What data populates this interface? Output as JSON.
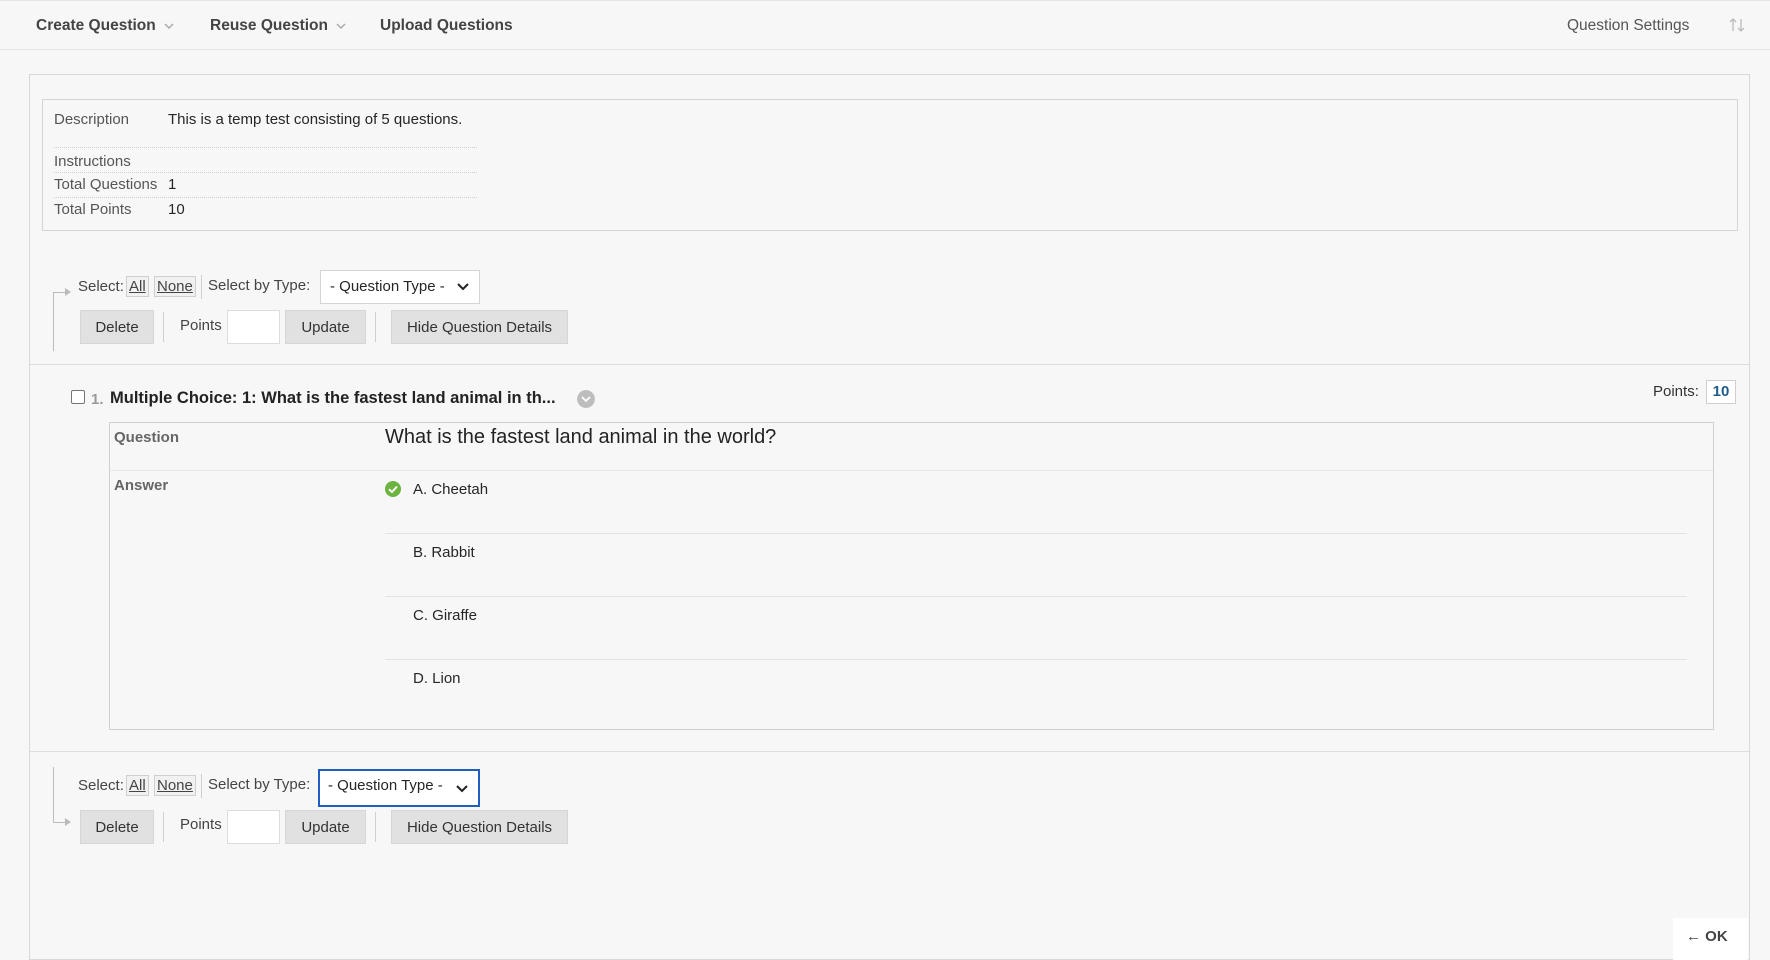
{
  "topbar": {
    "create_question": "Create Question",
    "reuse_question": "Reuse Question",
    "upload_questions": "Upload Questions",
    "question_settings": "Question Settings"
  },
  "info": {
    "description_label": "Description",
    "description_value": "This is a temp test consisting of 5 questions.",
    "instructions_label": "Instructions",
    "total_questions_label": "Total Questions",
    "total_questions_value": "1",
    "total_points_label": "Total Points",
    "total_points_value": "10"
  },
  "toolbar": {
    "select_label": "Select:",
    "all": "All",
    "none": "None",
    "select_by_type_label": "Select by Type:",
    "question_type_selected": "- Question Type -",
    "delete": "Delete",
    "points_label": "Points",
    "points_value": "",
    "update": "Update",
    "hide_details": "Hide Question Details"
  },
  "question": {
    "number": "1.",
    "title": "Multiple Choice: 1: What is the fastest land animal in th...",
    "points_label": "Points:",
    "points_value": "10",
    "question_label": "Question",
    "question_text": "What is the fastest land animal in the world?",
    "answer_label": "Answer",
    "answers": [
      {
        "text": "A. Cheetah",
        "correct": true
      },
      {
        "text": "B. Rabbit",
        "correct": false
      },
      {
        "text": "C. Giraffe",
        "correct": false
      },
      {
        "text": "D. Lion",
        "correct": false
      }
    ]
  },
  "footer": {
    "ok": "OK"
  },
  "colors": {
    "accent_focus": "#1f5fbf",
    "correct_check": "#6cb33f",
    "points_value": "#1d5c8c"
  },
  "icons": {
    "dropdown": "chevron-down-icon",
    "sort": "sort-arrows-icon",
    "correct": "check-circle-icon",
    "more": "chevron-circle-icon",
    "back": "left-arrow-icon"
  }
}
